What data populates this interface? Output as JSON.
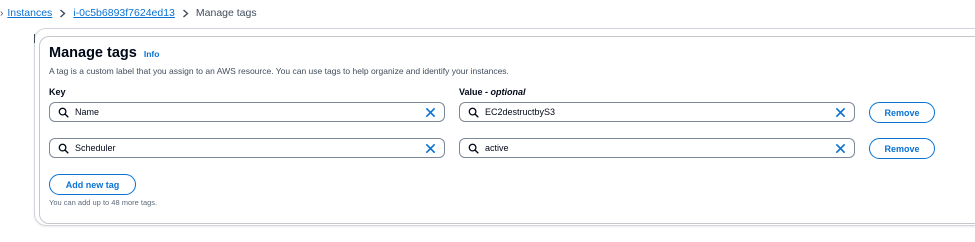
{
  "breadcrumb": {
    "leading_sep": "›",
    "items": [
      {
        "label": "Instances",
        "link": true
      },
      {
        "label": "i-0c5b6893f7624ed13",
        "link": true
      },
      {
        "label": "Manage tags",
        "link": false
      }
    ]
  },
  "section": {
    "title": "Manage tags",
    "info_label": "Info",
    "description": "A tag is a custom label that you assign to an AWS resource. You can use tags to help organize and identify your instances."
  },
  "columns": {
    "key_label": "Key",
    "value_label": "Value",
    "value_optional": "optional",
    "value_sep": " - "
  },
  "tags": [
    {
      "key": "Name",
      "value": "EC2destructbyS3",
      "remove_label": "Remove"
    },
    {
      "key": "Scheduler",
      "value": "active",
      "remove_label": "Remove"
    }
  ],
  "add_button_label": "Add new tag",
  "limit_hint": "You can add up to 48 more tags.",
  "colors": {
    "link": "#0972d3",
    "text": "#000716",
    "border": "#7d8998",
    "muted": "#5f6b7a"
  },
  "icons": {
    "search": "search-icon",
    "clear": "close-icon",
    "chevron": "chevron-right-icon"
  }
}
